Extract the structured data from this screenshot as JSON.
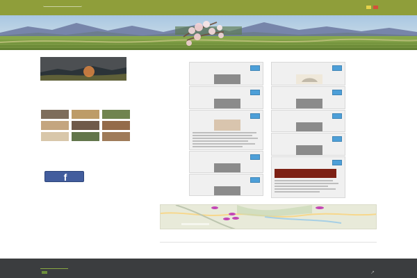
{
  "site": {
    "logo_text": ""
  },
  "nav": {
    "items": [
      "",
      "",
      "",
      "",
      "",
      "",
      "",
      "",
      "",
      ""
    ]
  },
  "hero": {
    "caption": "",
    "background": "#b7c9d8",
    "vineyard_green": "#6f8f38"
  },
  "sidebar": {
    "banner": {
      "title": ""
    },
    "intro_lines": [
      "",
      "",
      "",
      "",
      "",
      ""
    ],
    "accommodations_title": "",
    "accommodations_lines": [
      "",
      "",
      ""
    ],
    "photos_title": "",
    "weather": {
      "title": "",
      "days": [
        "",
        "",
        "",
        "",
        "",
        "",
        ""
      ],
      "highs": [
        "",
        "",
        "",
        "",
        "",
        "",
        ""
      ],
      "lows": [
        "",
        "",
        "",
        "",
        "",
        "",
        ""
      ],
      "conditions": [
        "",
        "",
        "",
        "",
        "",
        "",
        ""
      ]
    },
    "other_lines": [
      "",
      "",
      ""
    ],
    "facebook_label": "f"
  },
  "main": {
    "title": "",
    "cards": [
      {
        "title": ""
      },
      {
        "title": ""
      },
      {
        "title": ""
      },
      {
        "title": ""
      },
      {
        "title": ""
      },
      {
        "title": ""
      },
      {
        "title": ""
      },
      {
        "title": ""
      },
      {
        "title": ""
      },
      {
        "title": ""
      }
    ]
  },
  "map": {
    "title": ""
  },
  "footer": {
    "bottom_text": "",
    "logo_text": "",
    "icon": "↗"
  },
  "colors": {
    "nav": "#8f9e3a",
    "card_title": "#77a83c",
    "footer": "#3b3d3f",
    "badge": "#4d9fd8"
  }
}
